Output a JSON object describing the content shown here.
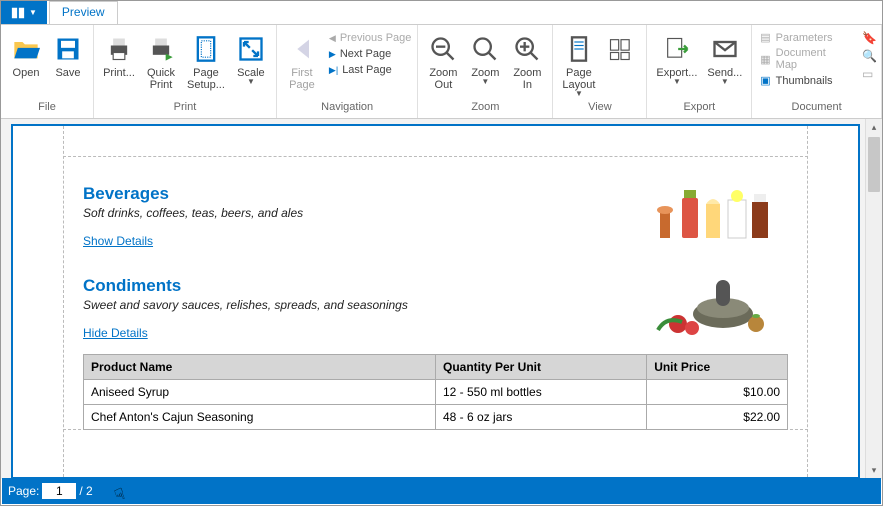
{
  "tabs": {
    "preview": "Preview"
  },
  "ribbon": {
    "file": {
      "label": "File",
      "open": "Open",
      "save": "Save"
    },
    "print": {
      "label": "Print",
      "print": "Print...",
      "quick": "Quick\nPrint",
      "setup": "Page\nSetup...",
      "scale": "Scale"
    },
    "nav": {
      "label": "Navigation",
      "first": "First\nPage",
      "prev": "Previous Page",
      "next": "Next Page",
      "last": "Last Page"
    },
    "zoom": {
      "label": "Zoom",
      "out": "Zoom\nOut",
      "zoom": "Zoom",
      "in": "Zoom\nIn"
    },
    "view": {
      "label": "View",
      "layout": "Page\nLayout"
    },
    "export": {
      "label": "Export",
      "export": "Export...",
      "send": "Send..."
    },
    "document": {
      "label": "Document",
      "params": "Parameters",
      "map": "Document Map",
      "thumbs": "Thumbnails"
    }
  },
  "report": {
    "beverages": {
      "title": "Beverages",
      "desc": "Soft drinks, coffees, teas, beers, and ales",
      "link": "Show Details"
    },
    "condiments": {
      "title": "Condiments",
      "desc": "Sweet and savory sauces, relishes, spreads, and seasonings",
      "link": "Hide Details",
      "cols": {
        "name": "Product Name",
        "qty": "Quantity Per Unit",
        "price": "Unit Price"
      },
      "rows": [
        {
          "name": "Aniseed Syrup",
          "qty": "12 - 550 ml bottles",
          "price": "$10.00"
        },
        {
          "name": "Chef Anton's Cajun Seasoning",
          "qty": "48 - 6 oz jars",
          "price": "$22.00"
        }
      ]
    }
  },
  "status": {
    "label": "Page:",
    "current": "1",
    "total": "/ 2"
  }
}
